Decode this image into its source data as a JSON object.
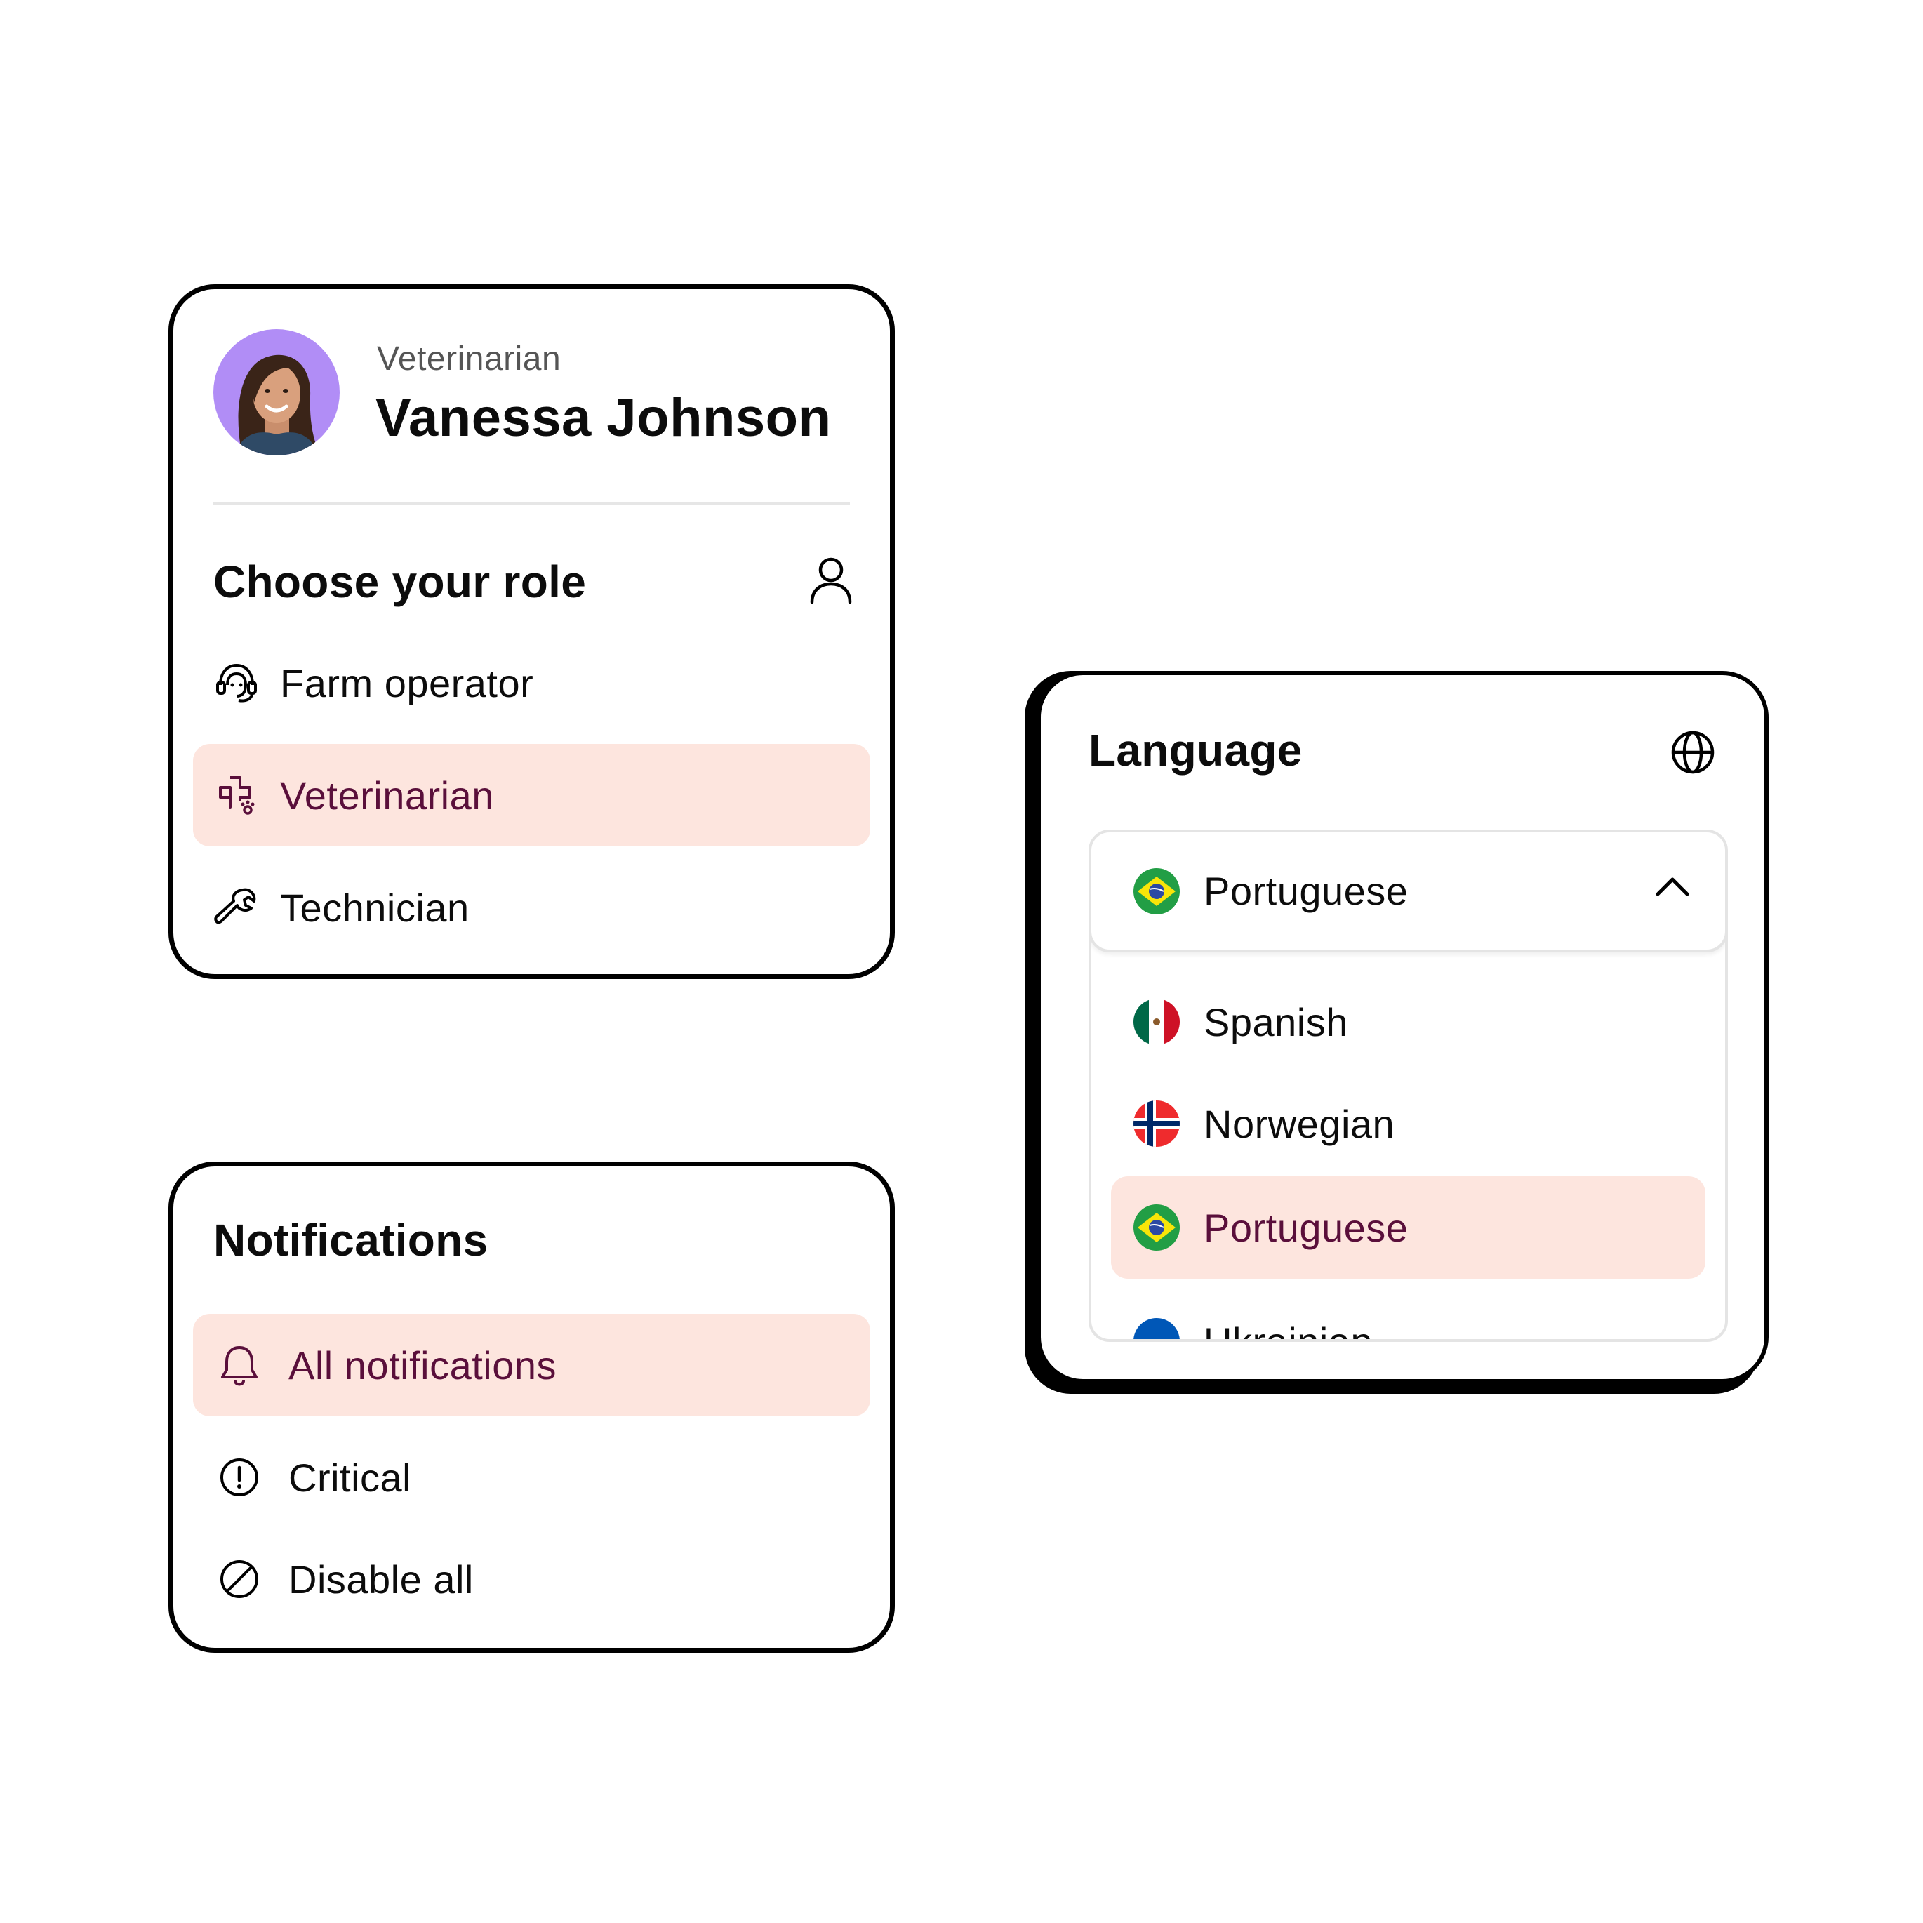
{
  "profile_card": {
    "role_caption": "Veterinarian",
    "name": "Vanessa Johnson",
    "section_title": "Choose your role",
    "roles": [
      {
        "label": "Farm operator",
        "icon": "headset-icon",
        "selected": false
      },
      {
        "label": "Veterinarian",
        "icon": "paw-medical-icon",
        "selected": true
      },
      {
        "label": "Technician",
        "icon": "wrench-icon",
        "selected": false
      }
    ]
  },
  "notifications_card": {
    "title": "Notifications",
    "options": [
      {
        "label": "All notifications",
        "icon": "bell-icon",
        "selected": true
      },
      {
        "label": "Critical",
        "icon": "alert-circle-icon",
        "selected": false
      },
      {
        "label": "Disable all",
        "icon": "block-icon",
        "selected": false
      }
    ]
  },
  "language_card": {
    "title": "Language",
    "selected_value": "Portuguese",
    "options": [
      {
        "label": "Spanish",
        "flag": "mexico-flag-icon",
        "selected": false
      },
      {
        "label": "Norwegian",
        "flag": "norway-flag-icon",
        "selected": false
      },
      {
        "label": "Portuguese",
        "flag": "brazil-flag-icon",
        "selected": true
      },
      {
        "label": "Ukrainian",
        "flag": "ukraine-flag-icon",
        "selected": false
      }
    ]
  },
  "colors": {
    "selected_bg": "#fde5de",
    "selected_text": "#5a0f3b",
    "avatar_bg": "#b18df6",
    "border": "#000000"
  }
}
